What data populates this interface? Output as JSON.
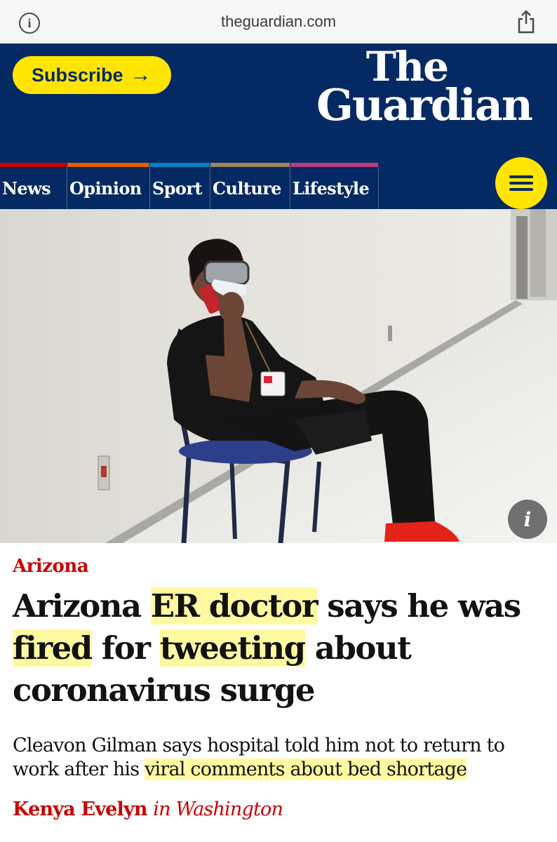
{
  "browser": {
    "url": "theguardian.com",
    "info_icon": "info-circle-icon",
    "share_icon": "share-icon"
  },
  "masthead": {
    "subscribe_label": "Subscribe",
    "subscribe_arrow": "→",
    "logo_line1": "The",
    "logo_line2": "Guardian",
    "brand_color": "#052962",
    "accent_color": "#ffe500"
  },
  "nav": {
    "items": [
      {
        "label": "News",
        "color": "#c70000"
      },
      {
        "label": "Opinion",
        "color": "#e05e00"
      },
      {
        "label": "Sport",
        "color": "#0084c6"
      },
      {
        "label": "Culture",
        "color": "#a1845c"
      },
      {
        "label": "Lifestyle",
        "color": "#bb3b80"
      }
    ],
    "menu_icon": "hamburger-menu-icon"
  },
  "hero": {
    "info_glyph": "i"
  },
  "article": {
    "kicker": "Arizona",
    "headline_parts": [
      "Arizona ",
      "ER doctor",
      " says he was ",
      "fired",
      " for ",
      "tweeting",
      " about coronavirus surge"
    ],
    "standfirst_parts": [
      "Cleavon Gilman says hospital told him not to return to work after his ",
      "viral comments about bed shortage"
    ],
    "byline_name": "Kenya Evelyn",
    "byline_location": "in Washington",
    "highlight_color": "#fff882"
  }
}
